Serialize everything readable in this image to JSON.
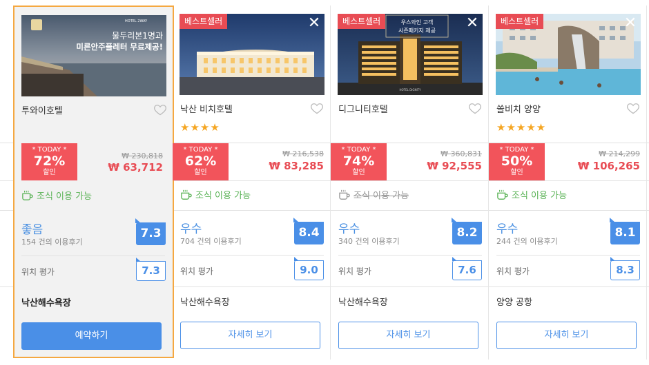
{
  "hotels": [
    {
      "name": "투와이호텔",
      "best_tag": "",
      "stars": "",
      "today_label": "* TODAY *",
      "discount": "72%",
      "discount_suffix": "할인",
      "original_price": "₩ 230,818",
      "sale_price": "₩ 63,712",
      "breakfast": "조식 이용 가능",
      "breakfast_available": true,
      "grade": "좋음",
      "reviews": "154 건의 이용후기",
      "score": "7.3",
      "location_label": "위치 평가",
      "location_score": "7.3",
      "landmark": "낙산해수욕장",
      "button": "예약하기",
      "thumb_text_line1": "물두리본1명과",
      "thumb_text_line2": "미른안주플레터 무료제공!",
      "thumb_brand": "HOTEL 2WAY"
    },
    {
      "name": "낙산 비치호텔",
      "best_tag": "베스트셀러",
      "stars": "★★★★",
      "today_label": "* TODAY *",
      "discount": "62%",
      "discount_suffix": "할인",
      "original_price": "₩ 216,538",
      "sale_price": "₩ 83,285",
      "breakfast": "조식 이용 가능",
      "breakfast_available": true,
      "grade": "우수",
      "reviews": "704 건의 이용후기",
      "score": "8.4",
      "location_label": "위치 평가",
      "location_score": "9.0",
      "landmark": "낙산해수욕장",
      "button": "자세히 보기"
    },
    {
      "name": "디그니티호텔",
      "best_tag": "베스트셀러",
      "stars": "",
      "today_label": "* TODAY *",
      "discount": "74%",
      "discount_suffix": "할인",
      "original_price": "₩ 360,831",
      "sale_price": "₩ 92,555",
      "breakfast": "조식 이용 가능",
      "breakfast_available": false,
      "grade": "우수",
      "reviews": "340 건의 이용후기",
      "score": "8.2",
      "location_label": "위치 평가",
      "location_score": "7.6",
      "landmark": "낙산해수욕장",
      "button": "자세히 보기",
      "thumb_text_line1": "우스와인 고객",
      "thumb_text_line2": "시즌패키지 제공",
      "thumb_brand": "HOTEL DIGNITY"
    },
    {
      "name": "쏠비치 양양",
      "best_tag": "베스트셀러",
      "stars": "★★★★★",
      "today_label": "* TODAY *",
      "discount": "50%",
      "discount_suffix": "할인",
      "original_price": "₩ 214,299",
      "sale_price": "₩ 106,265",
      "breakfast": "조식 이용 가능",
      "breakfast_available": true,
      "grade": "우수",
      "reviews": "244 건의 이용후기",
      "score": "8.1",
      "location_label": "위치 평가",
      "location_score": "8.3",
      "landmark": "양양 공항",
      "button": "자세히 보기"
    }
  ],
  "colors": {
    "accent_blue": "#4a8fe7",
    "discount_red": "#f2545b",
    "breakfast_green": "#5bb357",
    "star_orange": "#f5a623",
    "highlight_border": "#f5a841"
  },
  "icons": {
    "close": "close-icon",
    "heart": "heart-icon",
    "breakfast": "coffee-cup-icon"
  }
}
